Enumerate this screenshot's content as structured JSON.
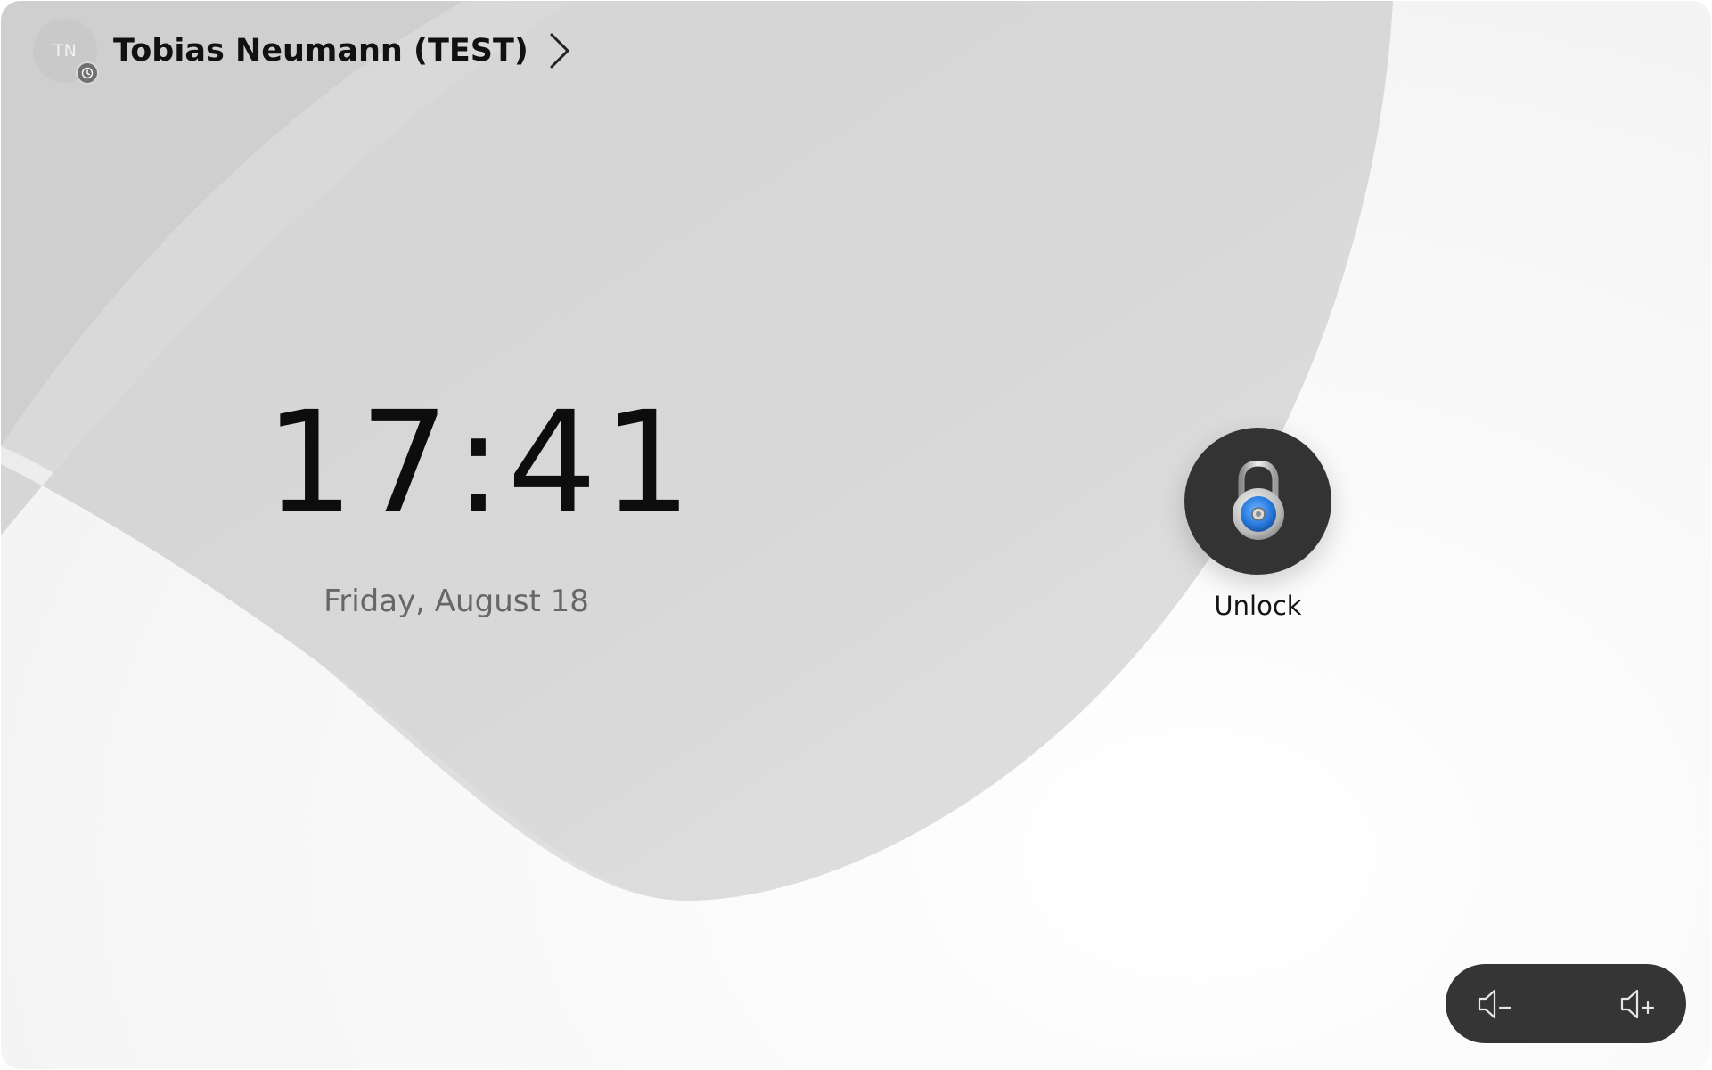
{
  "user": {
    "initials": "TN",
    "name": "Tobias Neumann (TEST)"
  },
  "clock": {
    "time": "17:41",
    "date": "Friday, August 18"
  },
  "unlock": {
    "label": "Unlock"
  },
  "volume": {
    "down_icon": "volume-down-icon",
    "up_icon": "volume-up-icon"
  },
  "colors": {
    "lock_blue": "#2a7de1",
    "control_dark": "#333333"
  }
}
